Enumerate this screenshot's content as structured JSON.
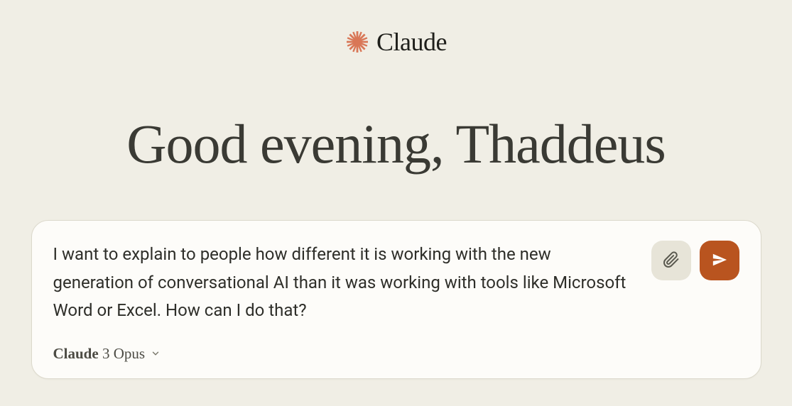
{
  "header": {
    "brand": "Claude"
  },
  "greeting": "Good evening, Thaddeus",
  "input": {
    "text": "I want to explain to people how different it is working with the new generation of conversational AI than it was working with tools like Microsoft Word or Excel. How can I do that?"
  },
  "model": {
    "brand": "Claude",
    "version": "3 Opus"
  }
}
